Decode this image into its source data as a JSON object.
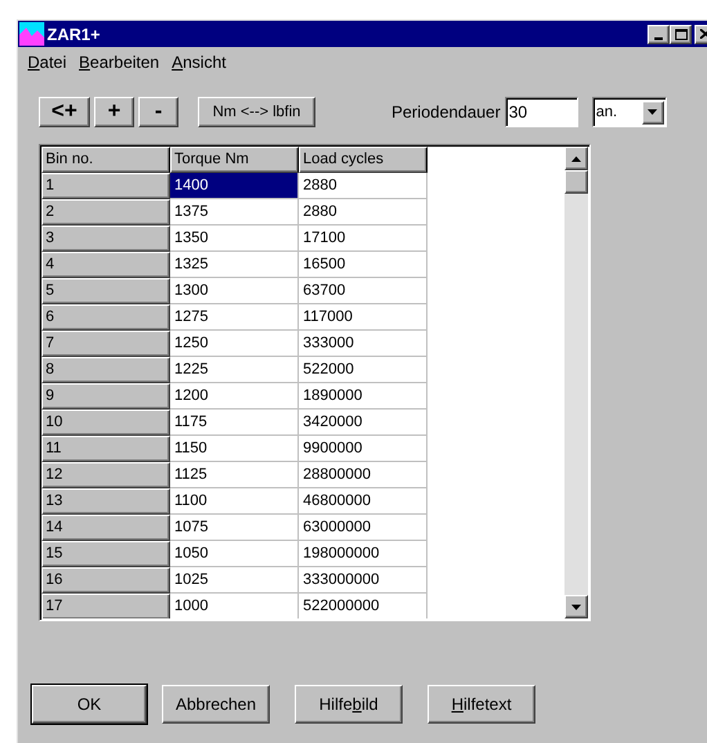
{
  "window": {
    "title": "ZAR1+"
  },
  "menu": [
    {
      "key": "D",
      "post": "atei"
    },
    {
      "key": "B",
      "post": "earbeiten"
    },
    {
      "key": "A",
      "post": "nsicht"
    }
  ],
  "toolbar": {
    "buttons": [
      "<+",
      "+",
      "-"
    ],
    "convert_button": "Nm <--> lbfin",
    "period_label": "Periodendauer",
    "period_value": "30",
    "unit_select": "an."
  },
  "table": {
    "columns": [
      "Bin no.",
      "Torque Nm",
      "Load cycles"
    ],
    "rows": [
      {
        "bin": "1",
        "torque": "1400",
        "load": "2880",
        "torque_selected": true
      },
      {
        "bin": "2",
        "torque": "1375",
        "load": "2880",
        "torque_selected": false
      },
      {
        "bin": "3",
        "torque": "1350",
        "load": "17100",
        "torque_selected": false
      },
      {
        "bin": "4",
        "torque": "1325",
        "load": "16500",
        "torque_selected": false
      },
      {
        "bin": "5",
        "torque": "1300",
        "load": "63700",
        "torque_selected": false
      },
      {
        "bin": "6",
        "torque": "1275",
        "load": "117000",
        "torque_selected": false
      },
      {
        "bin": "7",
        "torque": "1250",
        "load": "333000",
        "torque_selected": false
      },
      {
        "bin": "8",
        "torque": "1225",
        "load": "522000",
        "torque_selected": false
      },
      {
        "bin": "9",
        "torque": "1200",
        "load": "1890000",
        "torque_selected": false
      },
      {
        "bin": "10",
        "torque": "1175",
        "load": "3420000",
        "torque_selected": false
      },
      {
        "bin": "11",
        "torque": "1150",
        "load": "9900000",
        "torque_selected": false
      },
      {
        "bin": "12",
        "torque": "1125",
        "load": "28800000",
        "torque_selected": false
      },
      {
        "bin": "13",
        "torque": "1100",
        "load": "46800000",
        "torque_selected": false
      },
      {
        "bin": "14",
        "torque": "1075",
        "load": "63000000",
        "torque_selected": false
      },
      {
        "bin": "15",
        "torque": "1050",
        "load": "198000000",
        "torque_selected": false
      },
      {
        "bin": "16",
        "torque": "1025",
        "load": "333000000",
        "torque_selected": false
      },
      {
        "bin": "17",
        "torque": "1000",
        "load": "522000000",
        "torque_selected": false
      }
    ]
  },
  "buttons": [
    {
      "pre": "OK",
      "default": true
    },
    {
      "pre": "Abbrechen",
      "default": false
    },
    {
      "pre": "Hilfe",
      "key": "b",
      "post": "ild",
      "default": false
    },
    {
      "key": "H",
      "post": "ilfetext",
      "default": false
    }
  ]
}
